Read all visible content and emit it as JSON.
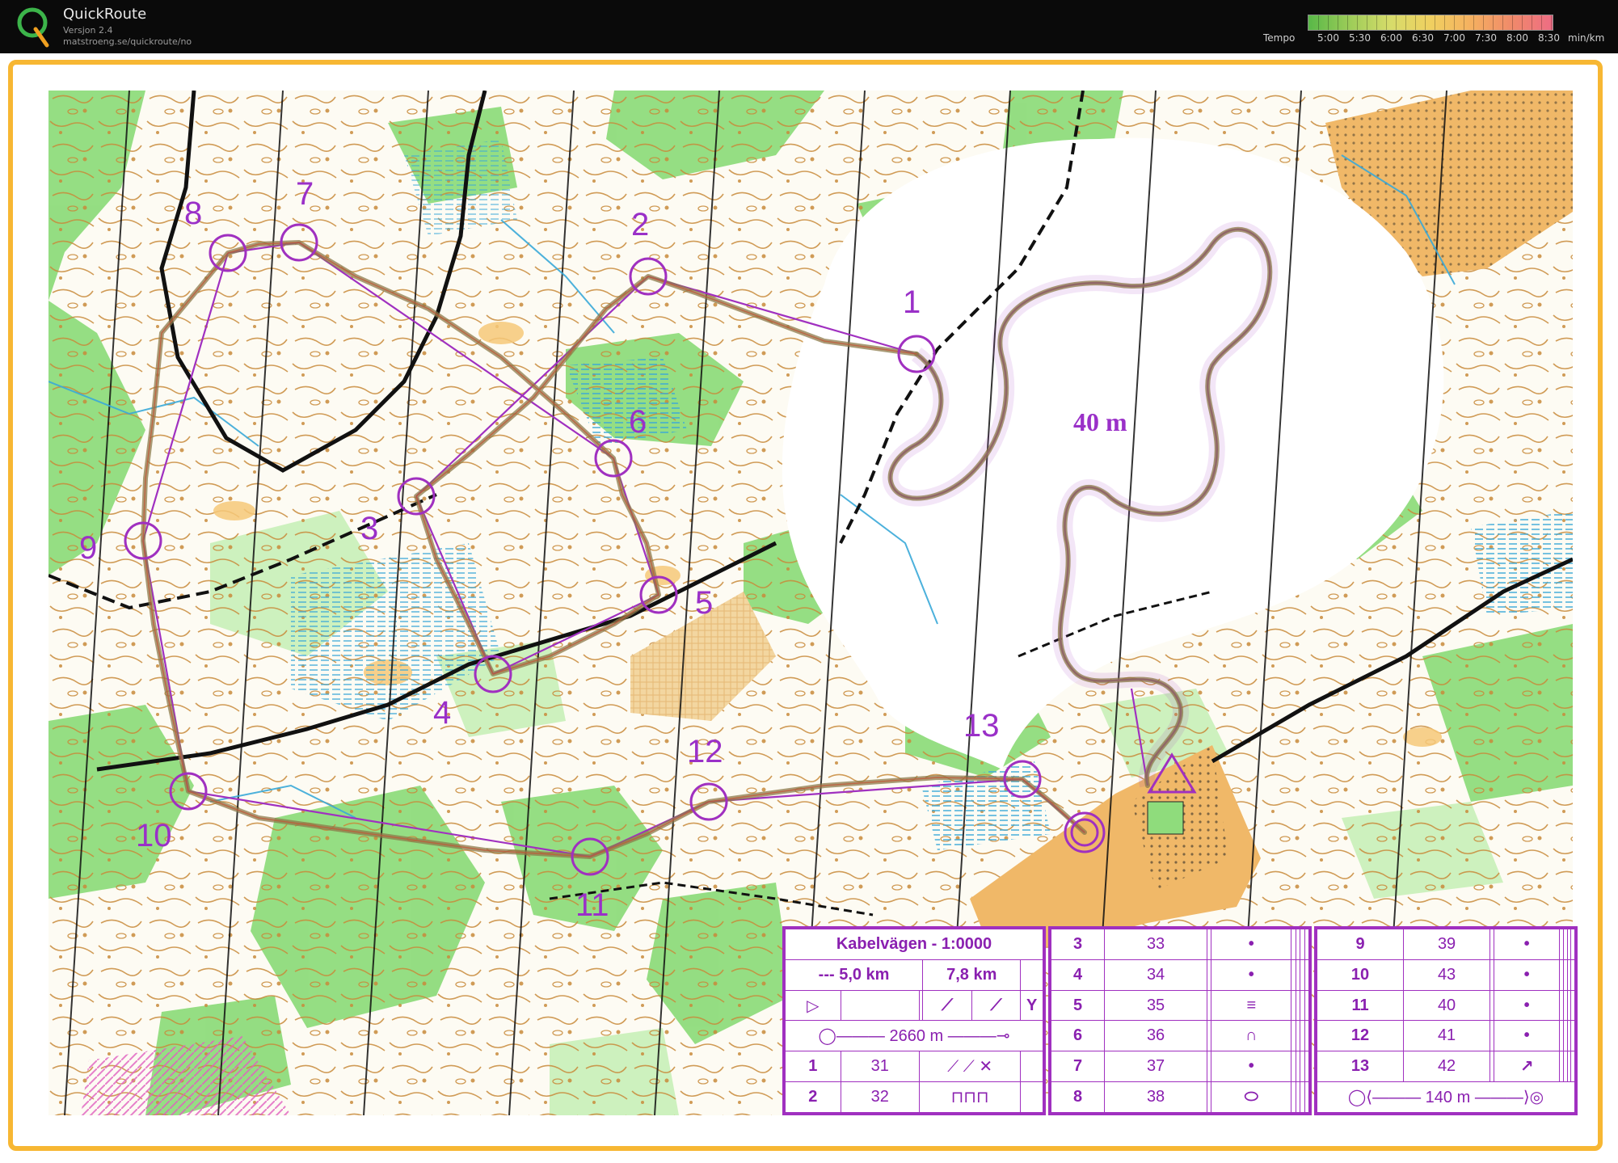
{
  "header": {
    "app_title": "QuickRoute",
    "version": "Versjon 2.4",
    "url": "matstroeng.se/quickroute/no",
    "tempo_label": "Tempo",
    "tempo_ticks": [
      "5:00",
      "5:30",
      "6:00",
      "6:30",
      "7:00",
      "7:30",
      "8:00",
      "8:30"
    ],
    "tempo_unit": "min/km"
  },
  "map": {
    "lake_label": "40 m",
    "controls": [
      {
        "label": "1"
      },
      {
        "label": "2"
      },
      {
        "label": "3"
      },
      {
        "label": "4"
      },
      {
        "label": "5"
      },
      {
        "label": "6"
      },
      {
        "label": "7"
      },
      {
        "label": "8"
      },
      {
        "label": "9"
      },
      {
        "label": "10"
      },
      {
        "label": "11"
      },
      {
        "label": "12"
      },
      {
        "label": "13"
      }
    ]
  },
  "description": {
    "title": "Kabelvägen - 1:0000",
    "distance_a": "--- 5,0 km",
    "distance_b": "7,8 km",
    "start_leg": "2660 m",
    "finish_leg": "140 m",
    "rows_a": [
      {
        "num": "1",
        "code": "31",
        "symbol": "⟋ ⟋ ✕"
      },
      {
        "num": "2",
        "code": "32",
        "symbol": "⊓⊓⊓"
      }
    ],
    "rows_b": [
      {
        "num": "3",
        "code": "33",
        "symbol": "•"
      },
      {
        "num": "4",
        "code": "34",
        "symbol": "•"
      },
      {
        "num": "5",
        "code": "35",
        "symbol": "≡"
      },
      {
        "num": "6",
        "code": "36",
        "symbol": "∩"
      },
      {
        "num": "7",
        "code": "37",
        "symbol": "•"
      },
      {
        "num": "8",
        "code": "38",
        "symbol": "⬭"
      }
    ],
    "rows_c": [
      {
        "num": "9",
        "code": "39",
        "symbol": "•"
      },
      {
        "num": "10",
        "code": "43",
        "symbol": "•"
      },
      {
        "num": "11",
        "code": "40",
        "symbol": "•"
      },
      {
        "num": "12",
        "code": "41",
        "symbol": "•"
      },
      {
        "num": "13",
        "code": "42",
        "symbol": "↗"
      }
    ]
  },
  "colors": {
    "frame": "#f7b733",
    "course": "#a030c0",
    "forest": "#7fd46c",
    "contour": "#c88a3a",
    "route": "#8c7a4a"
  }
}
